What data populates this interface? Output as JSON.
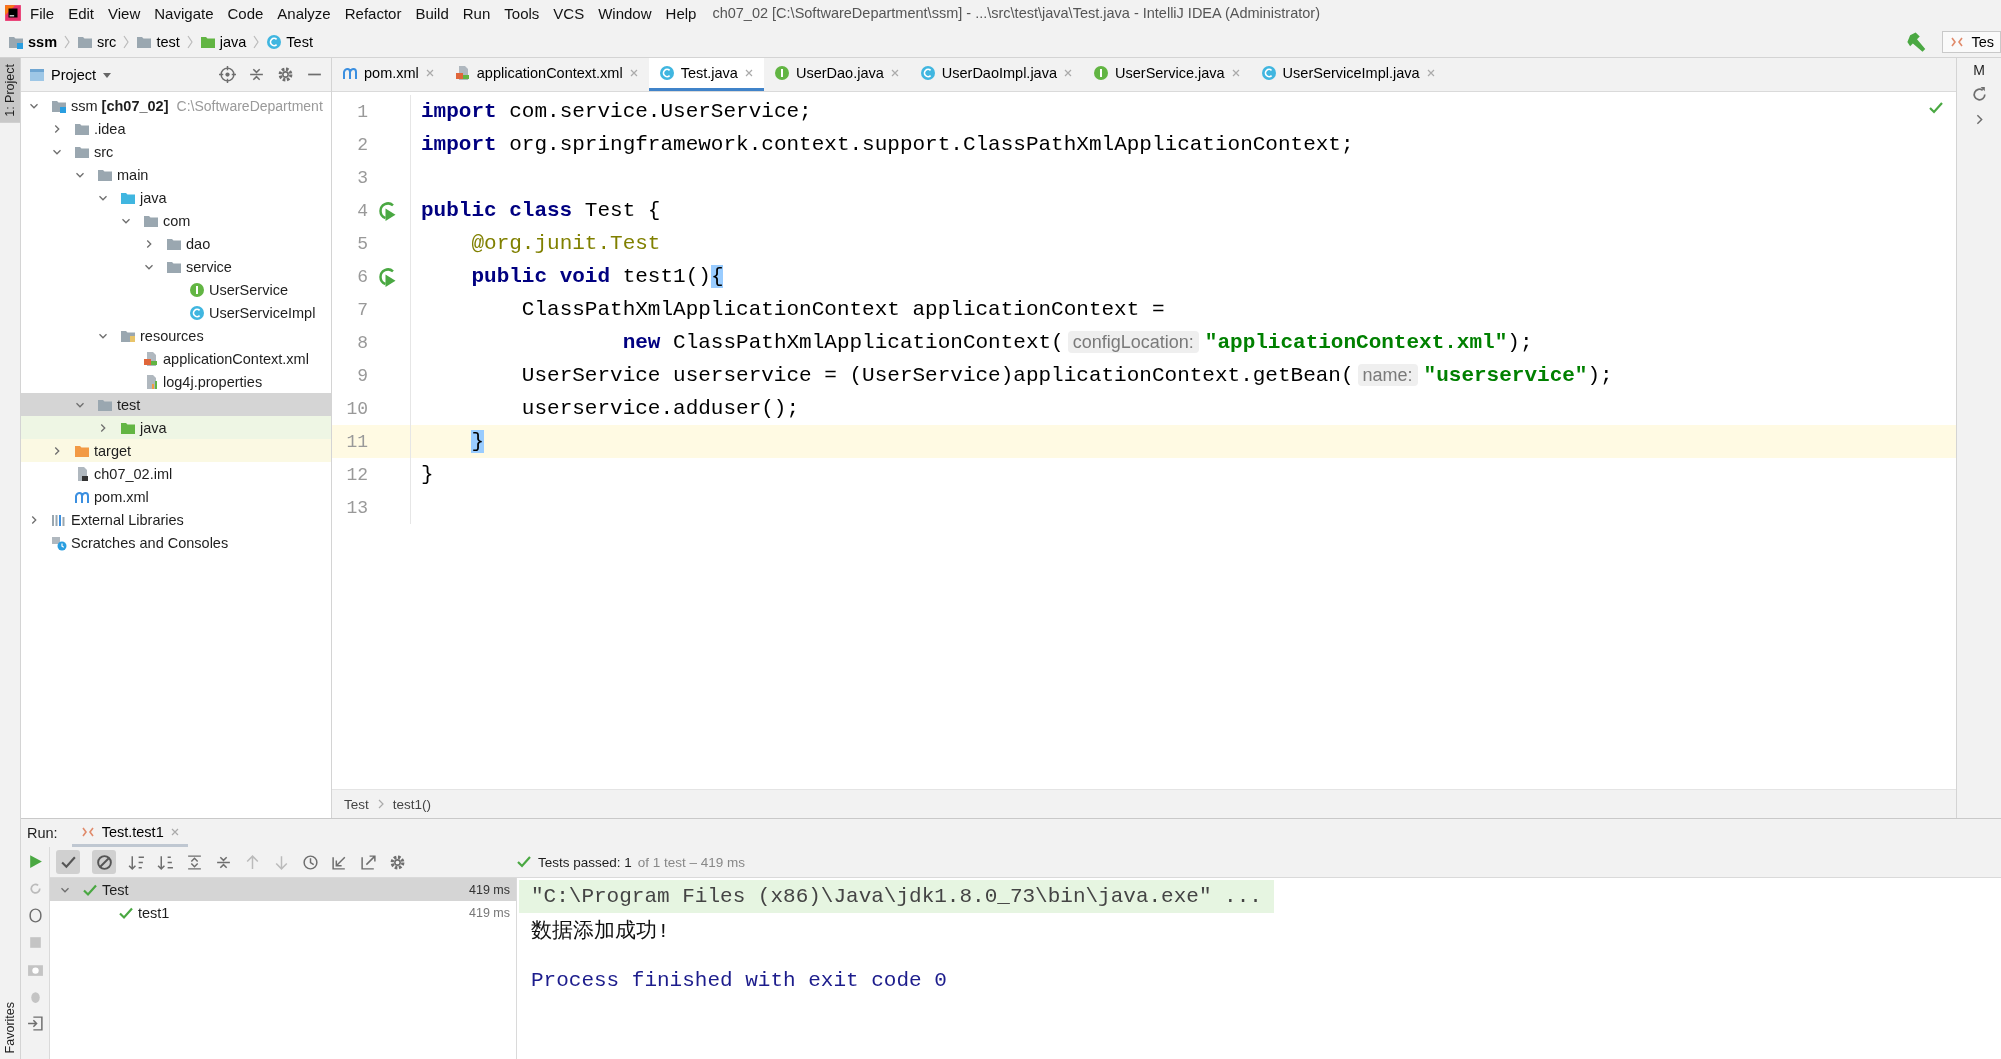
{
  "menu_bar": {
    "items": [
      "File",
      "Edit",
      "View",
      "Navigate",
      "Code",
      "Analyze",
      "Refactor",
      "Build",
      "Run",
      "Tools",
      "VCS",
      "Window",
      "Help"
    ],
    "title": "ch07_02 [C:\\SoftwareDepartment\\ssm] - ...\\src\\test\\java\\Test.java - IntelliJ IDEA (Administrator)"
  },
  "navigation_bar": {
    "crumbs": [
      {
        "label": "ssm",
        "kind": "module"
      },
      {
        "label": "src",
        "kind": "folder"
      },
      {
        "label": "test",
        "kind": "folder"
      },
      {
        "label": "java",
        "kind": "test-folder"
      },
      {
        "label": "Test",
        "kind": "class"
      }
    ],
    "run_configuration": "Tes"
  },
  "side_tabs": {
    "left_top": "1: Project",
    "left_bottom": "Favorites",
    "right_top": "M"
  },
  "project_panel": {
    "title": "Project",
    "tree": [
      {
        "label": "ssm **[ch07_02]**",
        "path": "C:\\SoftwareDepartment",
        "kind": "module",
        "expanded": true,
        "selected": false,
        "children": [
          {
            "label": ".idea",
            "kind": "folder",
            "expanded": false,
            "selected": false
          },
          {
            "label": "src",
            "kind": "folder",
            "expanded": true,
            "selected": false,
            "children": [
              {
                "label": "main",
                "kind": "folder",
                "expanded": true,
                "selected": false,
                "children": [
                  {
                    "label": "java",
                    "kind": "src-folder",
                    "expanded": true,
                    "selected": false,
                    "children": [
                      {
                        "label": "com",
                        "kind": "package",
                        "expanded": true,
                        "selected": false,
                        "children": [
                          {
                            "label": "dao",
                            "kind": "package",
                            "expanded": false,
                            "selected": false
                          },
                          {
                            "label": "service",
                            "kind": "package",
                            "expanded": true,
                            "selected": false,
                            "children": [
                              {
                                "label": "UserService",
                                "kind": "interface",
                                "selected": false
                              },
                              {
                                "label": "UserServiceImpl",
                                "kind": "class",
                                "selected": false
                              }
                            ]
                          }
                        ]
                      }
                    ]
                  },
                  {
                    "label": "resources",
                    "kind": "res-folder",
                    "expanded": true,
                    "selected": false,
                    "children": [
                      {
                        "label": "applicationContext.xml",
                        "kind": "xml",
                        "selected": false
                      },
                      {
                        "label": "log4j.properties",
                        "kind": "properties",
                        "selected": false
                      }
                    ]
                  }
                ]
              },
              {
                "label": "test",
                "kind": "folder",
                "expanded": true,
                "selected": true,
                "children": [
                  {
                    "label": "java",
                    "kind": "test-folder",
                    "expanded": false,
                    "selected": false
                  }
                ]
              }
            ]
          },
          {
            "label": "target",
            "kind": "excluded-folder",
            "expanded": false,
            "selected": false
          },
          {
            "label": "ch07_02.iml",
            "kind": "iml",
            "selected": false
          },
          {
            "label": "pom.xml",
            "kind": "maven",
            "selected": false
          }
        ]
      },
      {
        "label": "External Libraries",
        "kind": "libraries",
        "expanded": false,
        "selected": false
      },
      {
        "label": "Scratches and Consoles",
        "kind": "scratches",
        "selected": false
      }
    ]
  },
  "editor": {
    "tabs": [
      {
        "label": "pom.xml",
        "kind": "maven",
        "selected": false
      },
      {
        "label": "applicationContext.xml",
        "kind": "xml",
        "selected": false
      },
      {
        "label": "Test.java",
        "kind": "class",
        "selected": true
      },
      {
        "label": "UserDao.java",
        "kind": "interface",
        "selected": false
      },
      {
        "label": "UserDaoImpl.java",
        "kind": "class",
        "selected": false
      },
      {
        "label": "UserService.java",
        "kind": "interface",
        "selected": false
      },
      {
        "label": "UserServiceImpl.java",
        "kind": "class",
        "selected": false
      }
    ],
    "lines": [
      {
        "number": "1",
        "current": false,
        "run_marker": false,
        "tokens": [
          {
            "text": "import",
            "kind": "kw"
          },
          {
            "text": " com.service.UserService;",
            "kind": "plain"
          }
        ]
      },
      {
        "number": "2",
        "current": false,
        "run_marker": false,
        "tokens": [
          {
            "text": "import",
            "kind": "kw"
          },
          {
            "text": " org.springframework.context.support.ClassPathXmlApplicationContext;",
            "kind": "plain"
          }
        ]
      },
      {
        "number": "3",
        "current": false,
        "run_marker": false
      },
      {
        "number": "4",
        "current": false,
        "run_marker": true,
        "tokens": [
          {
            "text": "public class",
            "kind": "kw"
          },
          {
            "text": " Test {",
            "kind": "plain"
          }
        ]
      },
      {
        "number": "5",
        "current": false,
        "run_marker": false,
        "tokens": [
          {
            "text": "    @org.junit.Test",
            "kind": "ann"
          }
        ]
      },
      {
        "number": "6",
        "current": false,
        "run_marker": true,
        "tokens": [
          {
            "text": "    public void",
            "kind": "kw"
          },
          {
            "text": " test1()",
            "kind": "plain"
          },
          {
            "text": "{",
            "kind": "brace"
          }
        ]
      },
      {
        "number": "7",
        "current": false,
        "run_marker": false,
        "tokens": [
          {
            "text": "        ClassPathXmlApplicationContext applicationContext =",
            "kind": "plain"
          }
        ]
      },
      {
        "number": "8",
        "current": false,
        "run_marker": false,
        "tokens": [
          {
            "text": "                new",
            "kind": "kw"
          },
          {
            "text": " ClassPathXmlApplicationContext(",
            "kind": "plain"
          },
          {
            "text": "configLocation:",
            "kind": "hint"
          },
          {
            "text": "\"applicationContext.xml\"",
            "kind": "str"
          },
          {
            "text": ");",
            "kind": "plain"
          }
        ]
      },
      {
        "number": "9",
        "current": false,
        "run_marker": false,
        "tokens": [
          {
            "text": "        UserService userservice = (UserService)applicationContext.getBean(",
            "kind": "plain"
          },
          {
            "text": "name:",
            "kind": "hint"
          },
          {
            "text": "\"userservice\"",
            "kind": "str"
          },
          {
            "text": ");",
            "kind": "plain"
          }
        ]
      },
      {
        "number": "10",
        "current": false,
        "run_marker": false,
        "tokens": [
          {
            "text": "        userservice.adduser();",
            "kind": "plain"
          }
        ]
      },
      {
        "number": "11",
        "current": true,
        "run_marker": false,
        "tokens": [
          {
            "text": "    }",
            "kind": "brace"
          }
        ]
      },
      {
        "number": "12",
        "current": false,
        "run_marker": false,
        "tokens": [
          {
            "text": "}",
            "kind": "plain"
          }
        ]
      },
      {
        "number": "13",
        "current": false,
        "run_marker": false
      }
    ],
    "breadcrumbs": [
      "Test",
      "test1()"
    ]
  },
  "run_panel": {
    "label": "Run:",
    "tab": "Test.test1",
    "toggles": [
      {
        "kind": "passed",
        "on": true
      },
      {
        "kind": "ignored",
        "on": true
      }
    ],
    "status": "Tests passed: 1",
    "summary": "of 1 test – 419 ms",
    "tests": [
      {
        "label": "Test",
        "time": "419 ms",
        "passed": true,
        "expanded": true,
        "selected": true,
        "children": [
          {
            "label": "test1",
            "time": "419 ms",
            "passed": true,
            "selected": false
          }
        ]
      }
    ],
    "console": [
      {
        "text": "\"C:\\Program Files (x86)\\Java\\jdk1.8.0_73\\bin\\java.exe\" ...",
        "kind": "command"
      },
      {
        "text": "数据添加成功!",
        "kind": "output"
      },
      {
        "text": "Process finished with exit code 0",
        "kind": "exit"
      }
    ]
  }
}
